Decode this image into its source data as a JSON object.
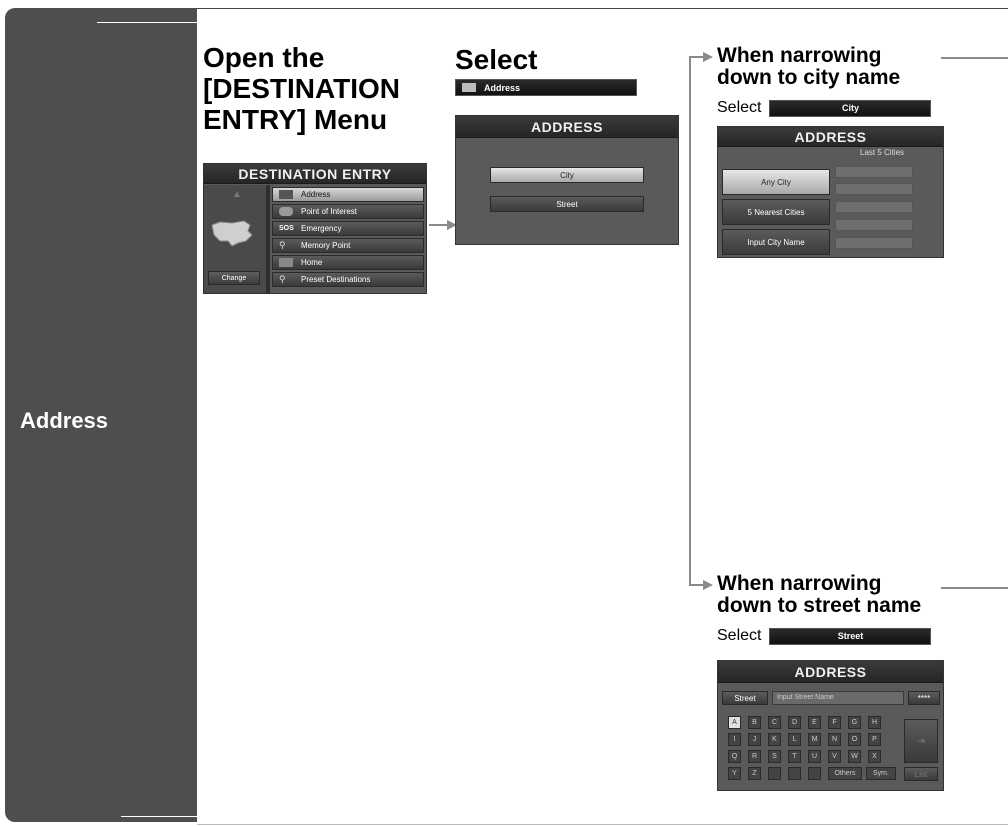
{
  "sidebar": {
    "label": "Address"
  },
  "step1": {
    "heading": [
      "Open the",
      "[DESTINATION",
      "ENTRY] Menu"
    ],
    "screen": {
      "title": "DESTINATION ENTRY",
      "items": [
        "Address",
        "Point of Interest",
        "Emergency",
        "Memory Point",
        "Home",
        "Preset Destinations"
      ],
      "change_label": "Change"
    }
  },
  "step2": {
    "heading": "Select",
    "button_label": "Address",
    "screen": {
      "title": "ADDRESS",
      "buttons": [
        "City",
        "Street"
      ]
    }
  },
  "branch_city": {
    "heading": [
      "When narrowing",
      "down to city name"
    ],
    "select_word": "Select",
    "button_label": "City",
    "screen": {
      "title": "ADDRESS",
      "column_label": "Last 5 Cities",
      "buttons": [
        "Any City",
        "5 Nearest Cities",
        "Input City Name"
      ]
    }
  },
  "branch_street": {
    "heading": [
      "When narrowing",
      "down to street name"
    ],
    "select_word": "Select",
    "button_label": "Street",
    "screen": {
      "title": "ADDRESS",
      "street_label": "Street",
      "input_placeholder": "Input Street Name",
      "masked": "****",
      "keys": [
        "A",
        "B",
        "C",
        "D",
        "E",
        "F",
        "G",
        "H",
        "I",
        "J",
        "K",
        "L",
        "M",
        "N",
        "O",
        "P",
        "Q",
        "R",
        "S",
        "T",
        "U",
        "V",
        "W",
        "X",
        "Y",
        "Z",
        "",
        "",
        "",
        ""
      ],
      "others_label": "Others",
      "sym_label": "Sym.",
      "list_label": "List"
    }
  }
}
